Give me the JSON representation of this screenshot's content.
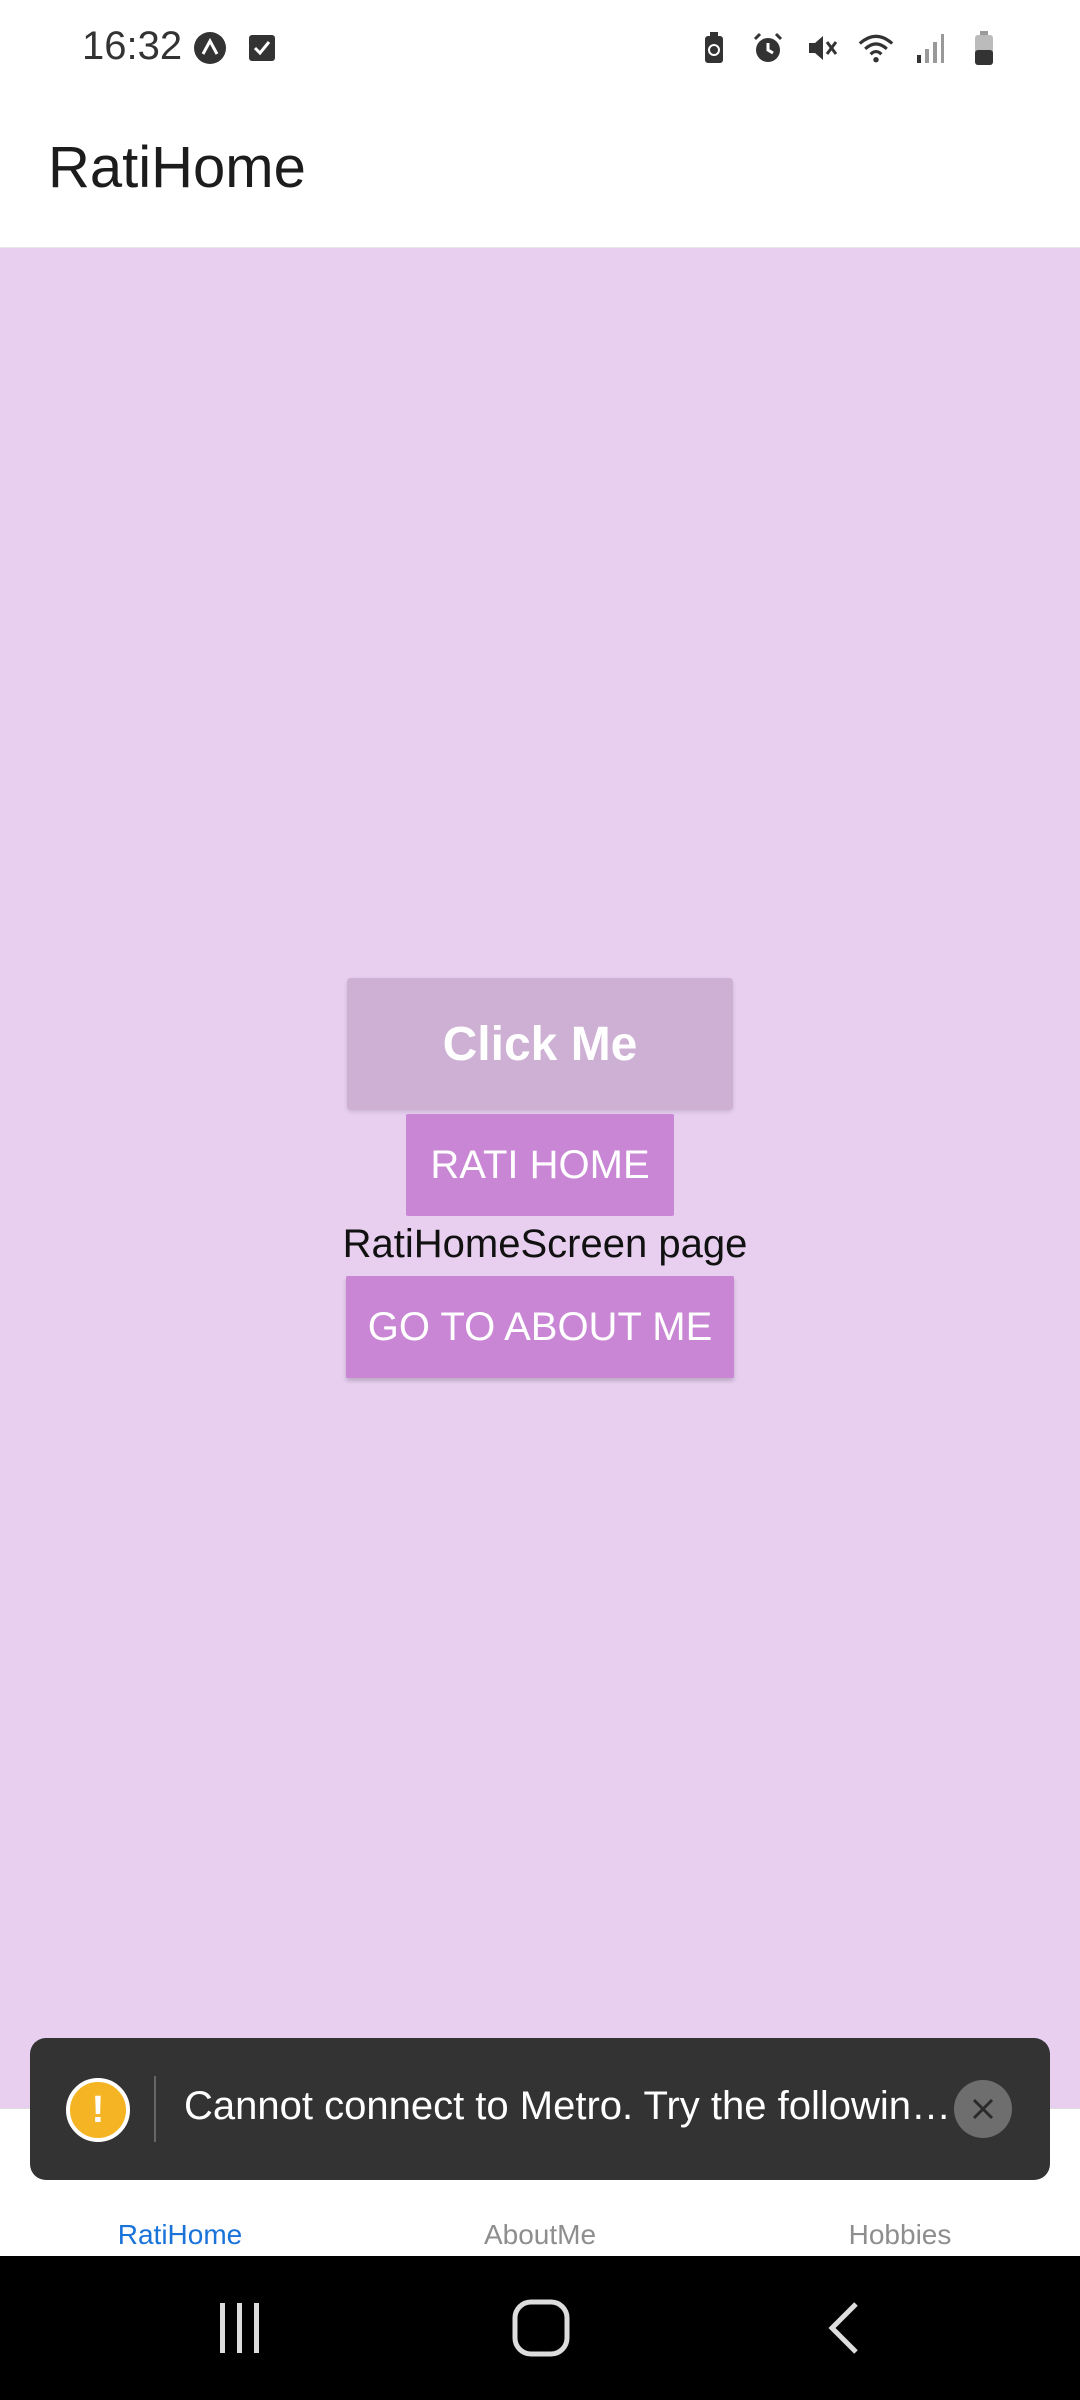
{
  "status_bar": {
    "time": "16:32",
    "left_icons": [
      "app-notification-icon",
      "checkbox-notification-icon"
    ],
    "right_icons": [
      "battery-saver-icon",
      "alarm-icon",
      "mute-icon",
      "wifi-icon",
      "signal-icon",
      "battery-icon"
    ]
  },
  "header": {
    "title": "RatiHome"
  },
  "main": {
    "click_me_label": "Click Me",
    "rati_home_label": "RATI HOME",
    "screen_label": "RatiHomeScreen page",
    "about_button_label": "GO TO ABOUT ME"
  },
  "tabs": [
    {
      "label": "RatiHome",
      "active": true
    },
    {
      "label": "AboutMe",
      "active": false
    },
    {
      "label": "Hobbies",
      "active": false
    }
  ],
  "toast": {
    "message": "Cannot connect to Metro.  Try the following to fix the issue:",
    "warning_symbol": "!"
  },
  "colors": {
    "background": "#e8cff0",
    "button": "#c886d4",
    "click_me": "#cdb0d3",
    "active_tab": "#1a73d9"
  }
}
